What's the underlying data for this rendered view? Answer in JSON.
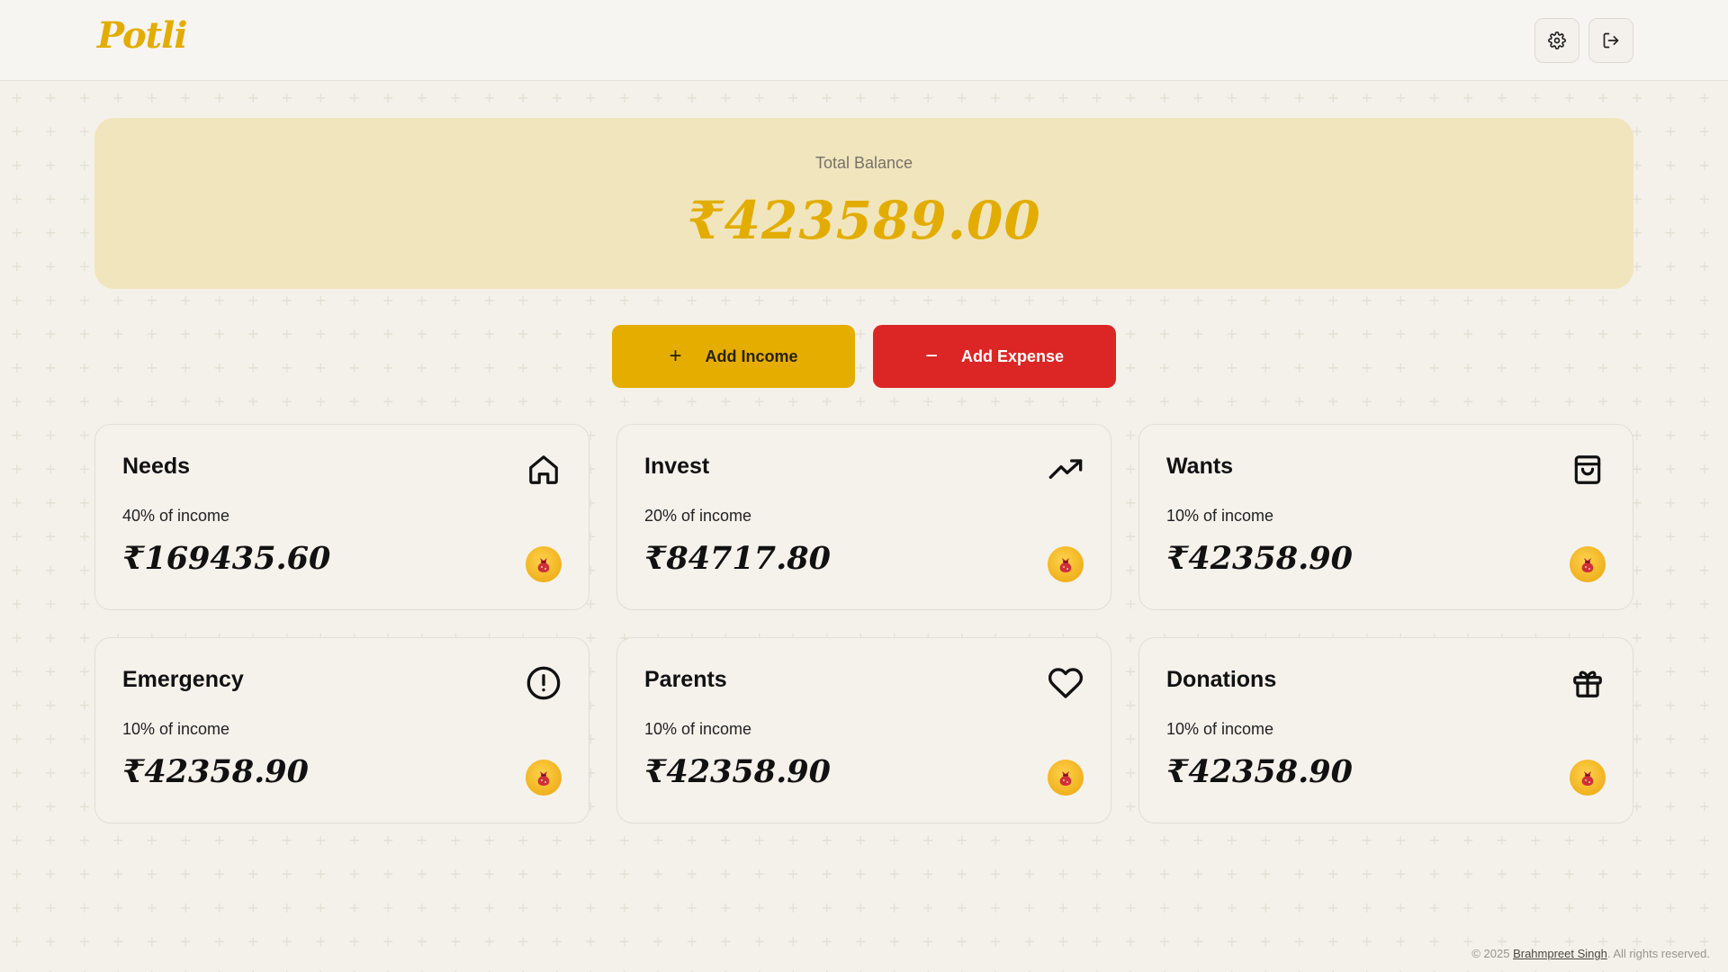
{
  "header": {
    "logo_text": "Potli",
    "settings_icon": "gear-icon",
    "logout_icon": "logout-icon"
  },
  "balance": {
    "label": "Total Balance",
    "amount": "₹423589.00"
  },
  "actions": {
    "income_label": "Add Income",
    "income_icon": "plus-icon",
    "expense_label": "Add Expense",
    "expense_icon": "minus-icon"
  },
  "cards": [
    {
      "title": "Needs",
      "subtitle": "40% of income",
      "amount": "₹169435.60",
      "icon": "home-icon"
    },
    {
      "title": "Invest",
      "subtitle": "20% of income",
      "amount": "₹84717.80",
      "icon": "trending-up-icon"
    },
    {
      "title": "Wants",
      "subtitle": "10% of income",
      "amount": "₹42358.90",
      "icon": "shopping-bag-icon"
    },
    {
      "title": "Emergency",
      "subtitle": "10% of income",
      "amount": "₹42358.90",
      "icon": "alert-circle-icon"
    },
    {
      "title": "Parents",
      "subtitle": "10% of income",
      "amount": "₹42358.90",
      "icon": "heart-icon"
    },
    {
      "title": "Donations",
      "subtitle": "10% of income",
      "amount": "₹42358.90",
      "icon": "gift-icon"
    }
  ],
  "footer": {
    "prefix": "© 2025 ",
    "author": "Brahmpreet Singh",
    "suffix": ". All rights reserved."
  },
  "colors": {
    "accent": "#e2ad00",
    "income_button": "#e5ad00",
    "expense_button": "#dc2626",
    "balance_bg": "#f1e5bd",
    "page_bg": "#f4f1ea"
  }
}
